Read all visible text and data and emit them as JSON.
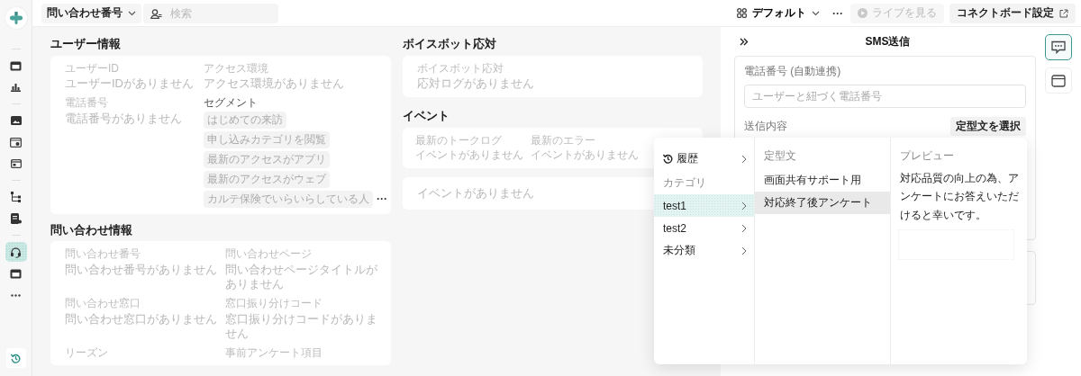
{
  "nav": {
    "groups": [
      {
        "items": [
          {
            "kind": "calendar",
            "selected": false
          },
          {
            "kind": "chart",
            "selected": false
          }
        ]
      },
      {
        "items": [
          {
            "kind": "image",
            "selected": false
          },
          {
            "kind": "gear-window",
            "selected": false
          },
          {
            "kind": "window",
            "selected": false
          }
        ]
      },
      {
        "items": [
          {
            "kind": "flow",
            "selected": false
          },
          {
            "kind": "document",
            "selected": false
          }
        ]
      },
      {
        "items": [
          {
            "kind": "headset",
            "selected": true
          },
          {
            "kind": "calendar",
            "selected": false
          },
          {
            "kind": "more",
            "selected": false
          }
        ]
      }
    ],
    "bottom": {
      "kind": "history"
    }
  },
  "top_bar": {
    "inquiry_dropdown": "問い合わせ番号",
    "search": {
      "placeholder": "検索"
    },
    "view_dropdown": "デフォルト",
    "more": "···",
    "live_button": {
      "label": "ライブを見る",
      "disabled": true
    },
    "connect_button": "コネクトボード設定"
  },
  "user_info": {
    "title": "ユーザー情報",
    "fields": [
      {
        "kind": "text",
        "label": "ユーザーID",
        "value": "ユーザーIDがありません"
      },
      {
        "kind": "text",
        "label": "アクセス環境",
        "value": "アクセス環境がありません"
      },
      {
        "kind": "text",
        "label": "電話番号",
        "value": "電話番号がありません"
      },
      {
        "kind": "tags",
        "label": "セグメント",
        "tags": [
          "はじめての来訪",
          "申し込みカテゴリを閲覧",
          "最新のアクセスがアプリ",
          "最新のアクセスがウェブ",
          "カルテ保険でいらいらしている人"
        ],
        "more": "···"
      }
    ]
  },
  "inquiry_info": {
    "title": "問い合わせ情報",
    "fields": [
      {
        "kind": "text",
        "label": "問い合わせ番号",
        "value": "問い合わせ番号がありません"
      },
      {
        "kind": "text",
        "label": "問い合わせページ",
        "value": "問い合わせページタイトルがありません"
      },
      {
        "kind": "text",
        "label": "問い合わせ窓口",
        "value": "問い合わせ窓口がありません"
      },
      {
        "kind": "text",
        "label": "窓口振り分けコード",
        "value": "窓口振り分けコードがありません"
      },
      {
        "kind": "text",
        "label": "リーズン"
      },
      {
        "kind": "text",
        "label": "事前アンケート項目"
      }
    ]
  },
  "voicebot": {
    "title": "ボイスボット応対",
    "fields": [
      {
        "kind": "text",
        "label": "ボイスボット応対",
        "value": "応対ログがありません"
      }
    ]
  },
  "events": {
    "title": "イベント",
    "fields": [
      {
        "kind": "text",
        "label": "最新のトークログ",
        "value": "イベントがありません"
      },
      {
        "kind": "text",
        "label": "最新のエラー",
        "value": "イベントがありません"
      }
    ],
    "timeline_empty": "イベントがありません"
  },
  "sms_panel": {
    "title": "SMS送信",
    "phone_label": "電話番号 (自動連携)",
    "phone_placeholder": "ユーザーと紐づく電話番号",
    "content_label": "送信内容",
    "template_button": "定型文を選択"
  },
  "template_menu": {
    "history": "履歴",
    "category_header": "カテゴリ",
    "categories": [
      {
        "label": "test1",
        "selected": true
      },
      {
        "label": "test2",
        "selected": false
      },
      {
        "label": "未分類",
        "selected": false
      }
    ],
    "template_header": "定型文",
    "templates": [
      {
        "label": "画面共有サポート用",
        "selected": false
      },
      {
        "label": "対応終了後アンケート",
        "selected": true
      }
    ],
    "preview_header": "プレビュー",
    "preview_text": "対応品質の向上の為、アンケートにお答えいただけると幸いです。"
  },
  "right_rail": [
    {
      "kind": "sms",
      "selected": true
    },
    {
      "kind": "browser",
      "selected": false
    }
  ]
}
